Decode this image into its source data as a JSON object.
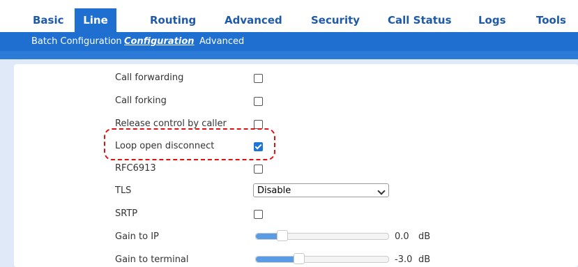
{
  "nav": {
    "tabs": [
      "Basic",
      "Line",
      "Routing",
      "Advanced",
      "Security",
      "Call Status",
      "Logs",
      "Tools"
    ],
    "active": "Line"
  },
  "subnav": {
    "items": [
      "Batch Configuration",
      "Configuration",
      "Advanced"
    ],
    "active": "Configuration"
  },
  "form": {
    "call_forwarding": {
      "label": "Call forwarding",
      "checked": false
    },
    "call_forking": {
      "label": "Call forking",
      "checked": false
    },
    "release_control": {
      "label": "Release control by caller",
      "checked": false
    },
    "loop_open": {
      "label": "Loop open disconnect",
      "checked": true
    },
    "rfc6913": {
      "label": "RFC6913",
      "checked": false
    },
    "tls": {
      "label": "TLS",
      "value": "Disable"
    },
    "srtp": {
      "label": "SRTP",
      "checked": false
    },
    "gain_ip": {
      "label": "Gain to IP",
      "value": "0.0",
      "unit": "dB"
    },
    "gain_terminal": {
      "label": "Gain to terminal",
      "value": "-3.0",
      "unit": "dB"
    }
  },
  "colors": {
    "nav_blue": "#1f6fd1",
    "highlight": "#e01010"
  }
}
